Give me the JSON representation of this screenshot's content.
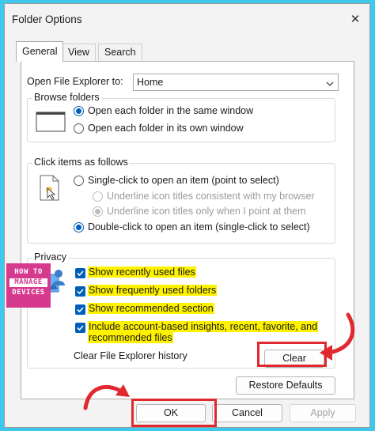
{
  "window": {
    "title": "Folder Options",
    "close_glyph": "✕"
  },
  "tabs": [
    {
      "label": "General",
      "active": true
    },
    {
      "label": "View",
      "active": false
    },
    {
      "label": "Search",
      "active": false
    }
  ],
  "open_explorer": {
    "label": "Open File Explorer to:",
    "value": "Home"
  },
  "browse_folders": {
    "label": "Browse folders",
    "options": [
      {
        "label": "Open each folder in the same window",
        "checked": true
      },
      {
        "label": "Open each folder in its own window",
        "checked": false
      }
    ]
  },
  "click_items": {
    "label": "Click items as follows",
    "single_click": "Single-click to open an item (point to select)",
    "underline_consistent": "Underline icon titles consistent with my browser",
    "underline_point": "Underline icon titles only when I point at them",
    "double_click": "Double-click to open an item (single-click to select)"
  },
  "privacy": {
    "label": "Privacy",
    "checks": [
      {
        "label": "Show recently used files",
        "checked": true
      },
      {
        "label": "Show frequently used folders",
        "checked": true
      },
      {
        "label": "Show recommended section",
        "checked": true
      },
      {
        "label": "Include account-based insights, recent, favorite, and",
        "label2": "recommended files",
        "checked": true
      }
    ],
    "clear_history_label": "Clear File Explorer history",
    "clear_button": "Clear"
  },
  "restore_button": "Restore Defaults",
  "footer": {
    "ok": "OK",
    "cancel": "Cancel",
    "apply": "Apply"
  },
  "watermark": {
    "line1": "HOW TO",
    "line2": "MANAGE",
    "line3": "DEVICES"
  },
  "colors": {
    "accent": "#005fb8",
    "highlight": "#fff200",
    "annotation": "#e0282f",
    "background": "#3ec8ee"
  }
}
